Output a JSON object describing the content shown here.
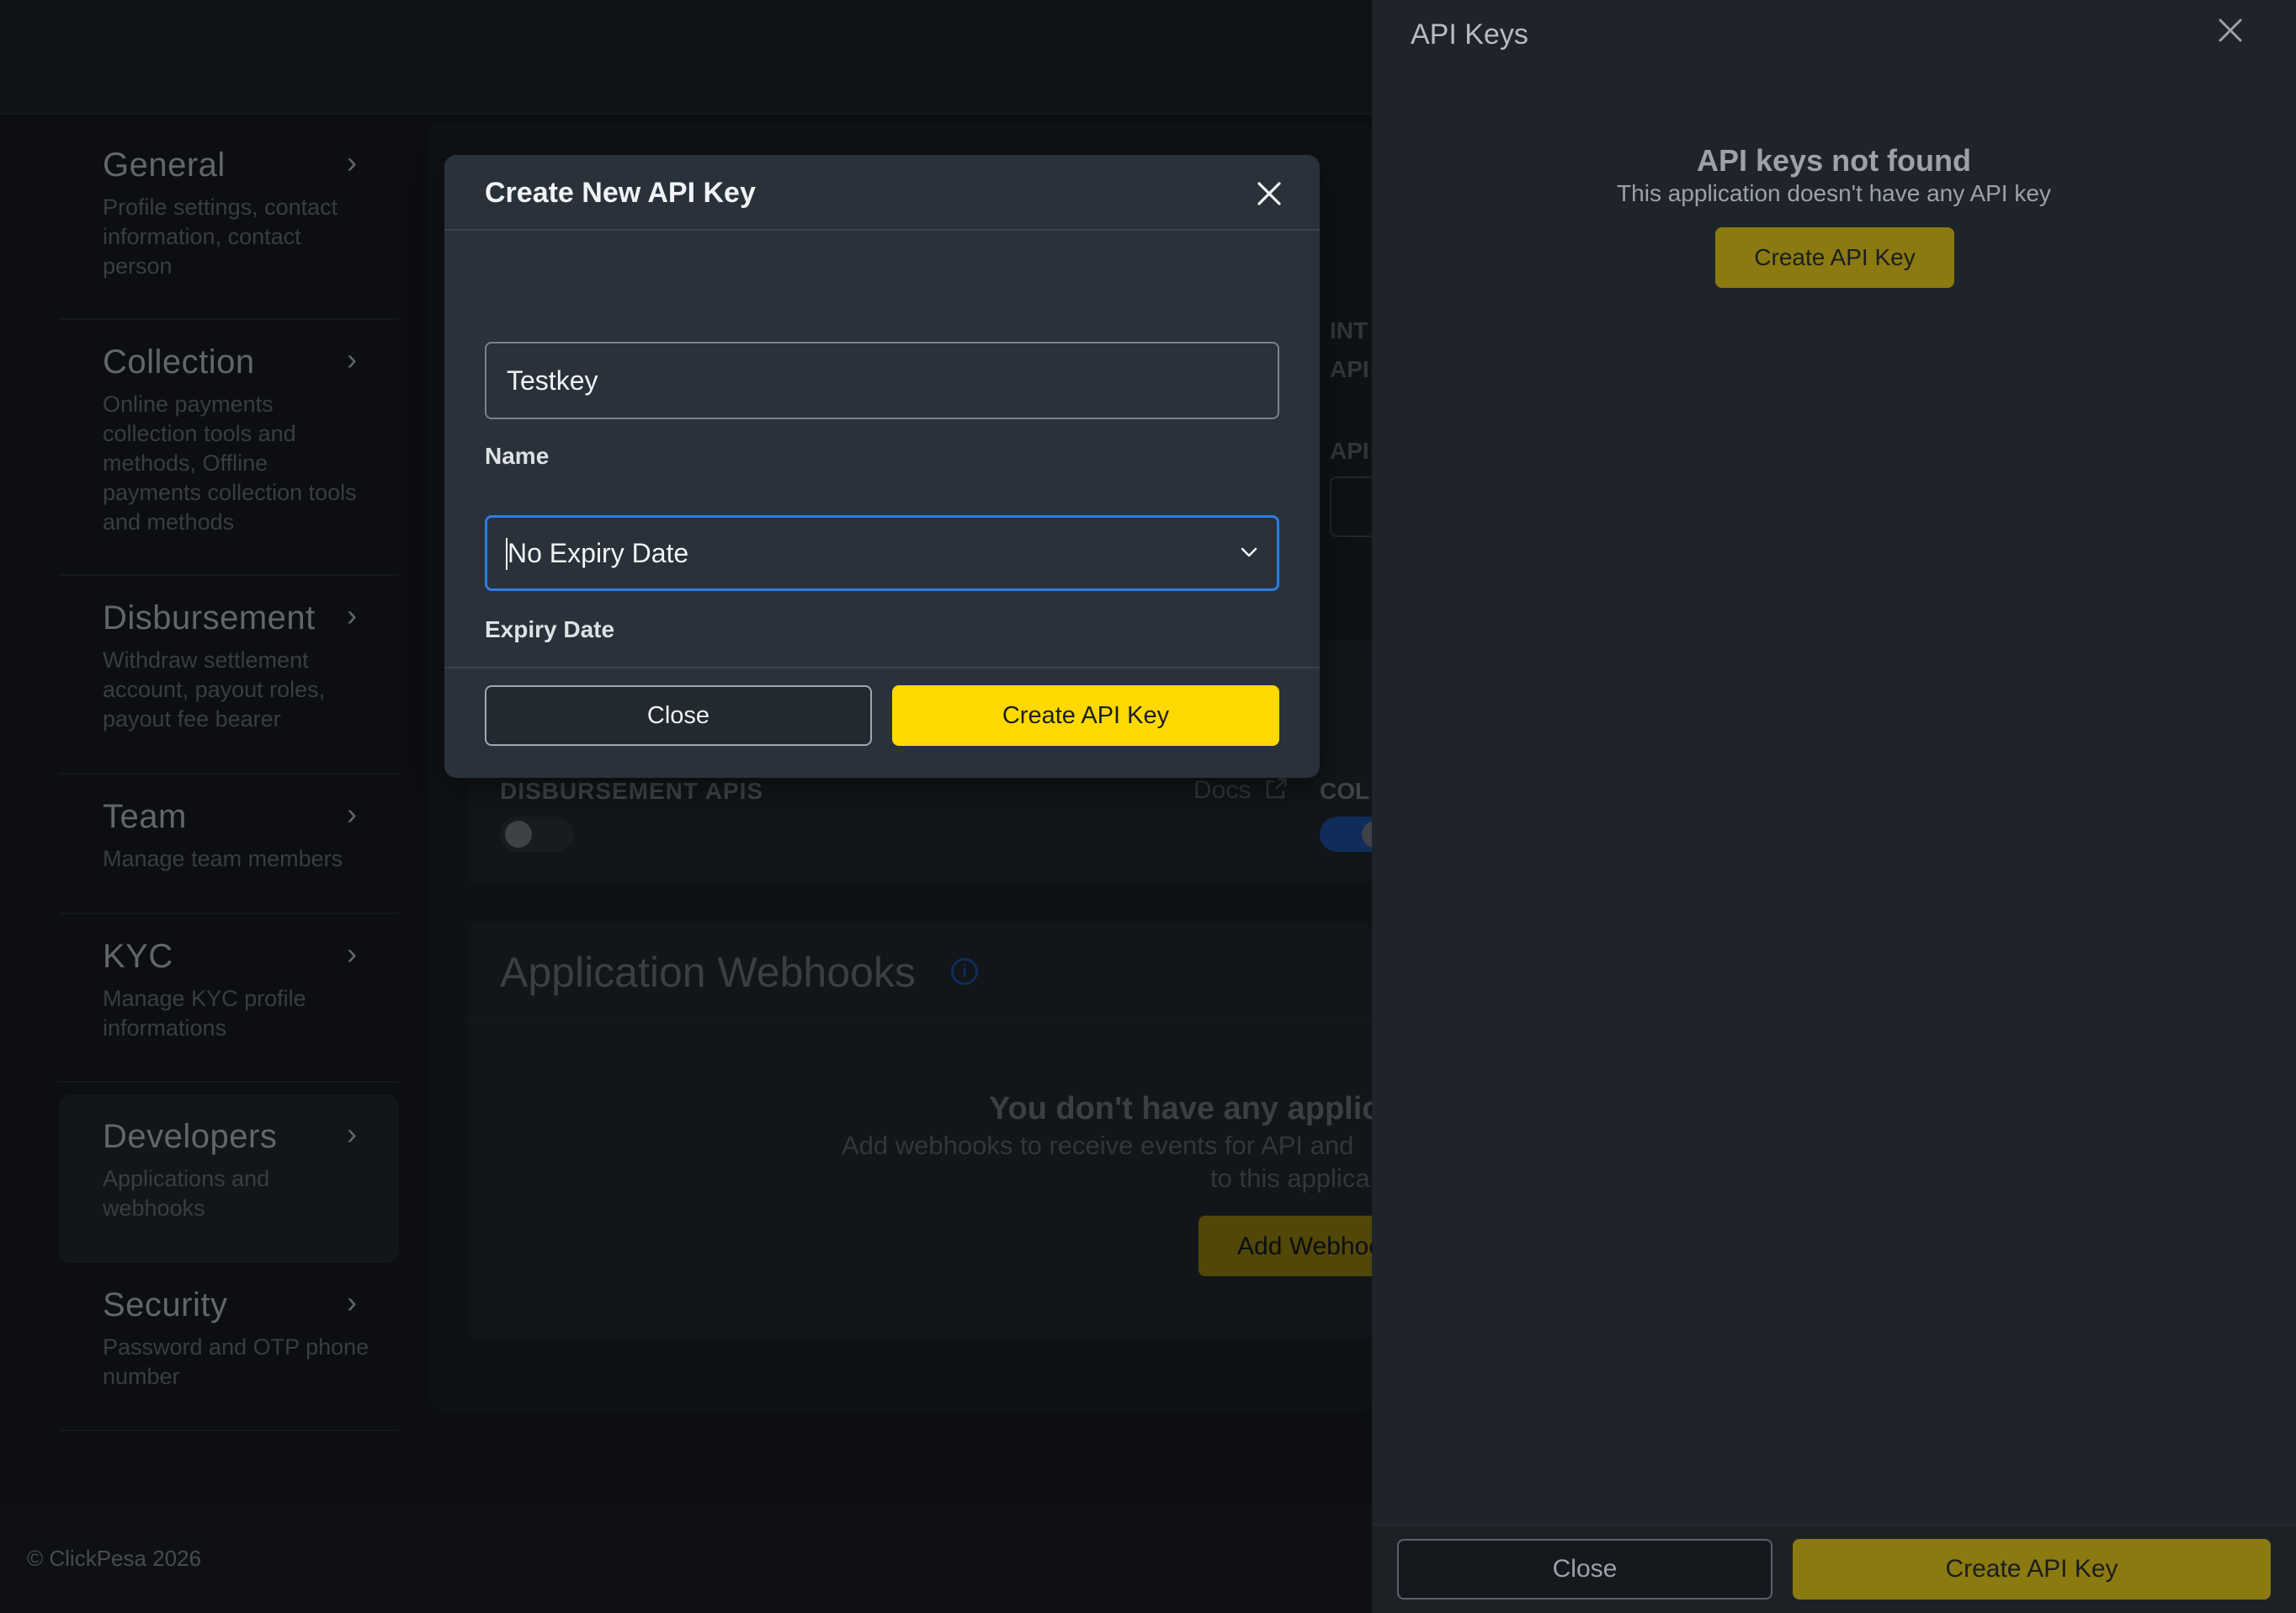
{
  "sidebar": {
    "items": [
      {
        "title": "General",
        "desc": "Profile settings, contact information, contact person"
      },
      {
        "title": "Collection",
        "desc": "Online payments collection tools and methods, Offline payments collection tools and methods"
      },
      {
        "title": "Disbursement",
        "desc": "Withdraw settlement account, payout roles, payout fee bearer"
      },
      {
        "title": "Team",
        "desc": "Manage team members"
      },
      {
        "title": "KYC",
        "desc": "Manage KYC profile informations"
      },
      {
        "title": "Developers",
        "desc": "Applications and webhooks"
      },
      {
        "title": "Security",
        "desc": "Password and OTP phone number"
      }
    ],
    "chevron": "›"
  },
  "background": {
    "int_label": "INT",
    "api_label_1": "API",
    "api_label_2": "API",
    "disbursement_label": "DISBURSEMENT APIS",
    "docs": "Docs",
    "col_label": "COL",
    "webhooks_title": "Application Webhooks",
    "empty_title": "You don't have any applica",
    "empty_desc": "Add webhooks to receive events for API and",
    "empty_desc2": "to this applica",
    "add_webhook": "Add Webhoo",
    "copyright": "© ClickPesa 2026"
  },
  "drawer": {
    "title": "API Keys",
    "not_found_title": "API keys not found",
    "not_found_desc": "This application doesn't have any API key",
    "create_button": "Create API Key",
    "footer_close": "Close",
    "footer_create": "Create API Key"
  },
  "modal": {
    "title": "Create New API Key",
    "name_label": "Name",
    "name_value": "Testkey",
    "expiry_label": "Expiry Date",
    "expiry_value": "No Expiry Date",
    "close_button": "Close",
    "create_button": "Create API Key"
  },
  "colors": {
    "accent_yellow": "#ffd900",
    "focus_blue": "#2f7ce0",
    "muted_yellow": "#8a7a10"
  }
}
